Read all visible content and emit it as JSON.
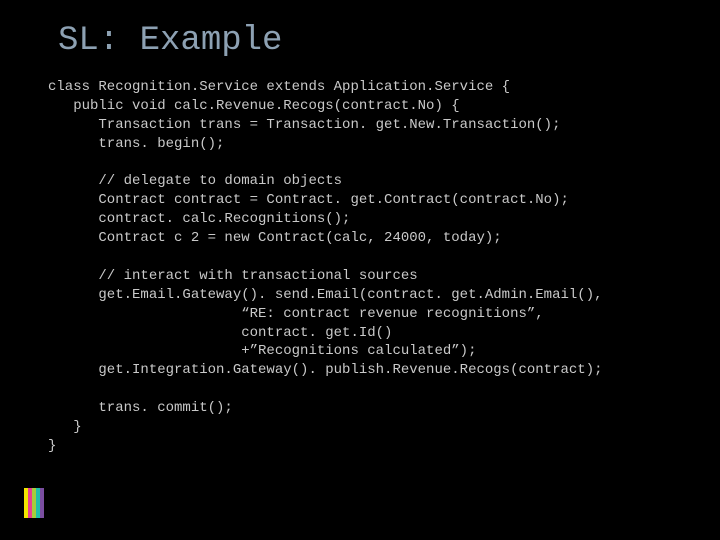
{
  "title": "SL: Example",
  "stripe_colors": [
    "#f2e600",
    "#e83f8f",
    "#a7cc3b",
    "#20bfa9",
    "#7a4ea0"
  ],
  "code": {
    "l01": "class Recognition.Service extends Application.Service {",
    "l02": "   public void calc.Revenue.Recogs(contract.No) {",
    "l03": "      Transaction trans = Transaction. get.New.Transaction();",
    "l04": "      trans. begin();",
    "l05": "",
    "l06": "      // delegate to domain objects",
    "l07": "      Contract contract = Contract. get.Contract(contract.No);",
    "l08": "      contract. calc.Recognitions();",
    "l09": "      Contract c 2 = new Contract(calc, 24000, today);",
    "l10": "",
    "l11": "      // interact with transactional sources",
    "l12": "      get.Email.Gateway(). send.Email(contract. get.Admin.Email(),",
    "l13": "                       “RE: contract revenue recognitions”,",
    "l14": "                       contract. get.Id()",
    "l15": "                       +”Recognitions calculated”);",
    "l16": "      get.Integration.Gateway(). publish.Revenue.Recogs(contract);",
    "l17": "",
    "l18": "      trans. commit();",
    "l19": "   }",
    "l20": "}"
  }
}
